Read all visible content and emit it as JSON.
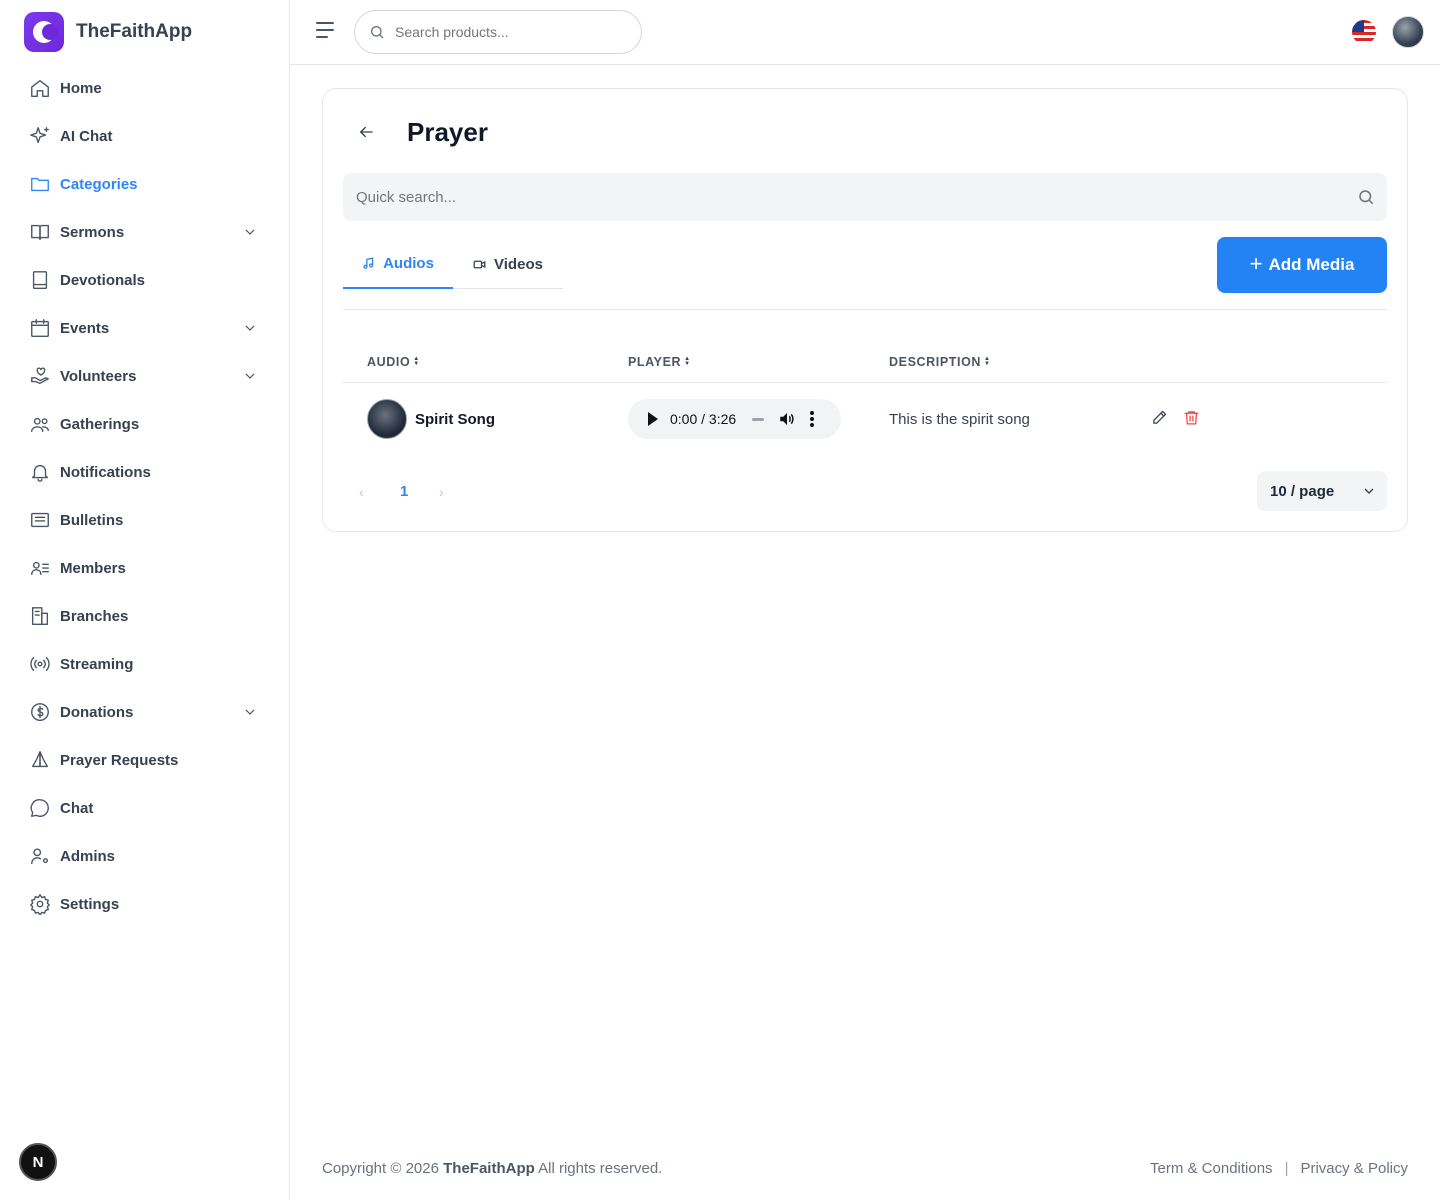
{
  "brand": {
    "name": "TheFaithApp"
  },
  "sidebar": {
    "items": [
      {
        "label": "Home",
        "icon": "home-icon",
        "has_chevron": false,
        "active": false
      },
      {
        "label": "AI Chat",
        "icon": "sparkles-icon",
        "has_chevron": false,
        "active": false
      },
      {
        "label": "Categories",
        "icon": "folder-icon",
        "has_chevron": false,
        "active": true
      },
      {
        "label": "Sermons",
        "icon": "book-open-icon",
        "has_chevron": true,
        "active": false
      },
      {
        "label": "Devotionals",
        "icon": "book-icon",
        "has_chevron": false,
        "active": false
      },
      {
        "label": "Events",
        "icon": "calendar-icon",
        "has_chevron": true,
        "active": false
      },
      {
        "label": "Volunteers",
        "icon": "hand-heart-icon",
        "has_chevron": true,
        "active": false
      },
      {
        "label": "Gatherings",
        "icon": "users-icon",
        "has_chevron": false,
        "active": false
      },
      {
        "label": "Notifications",
        "icon": "bell-icon",
        "has_chevron": false,
        "active": false
      },
      {
        "label": "Bulletins",
        "icon": "newspaper-icon",
        "has_chevron": false,
        "active": false
      },
      {
        "label": "Members",
        "icon": "user-list-icon",
        "has_chevron": false,
        "active": false
      },
      {
        "label": "Branches",
        "icon": "building-icon",
        "has_chevron": false,
        "active": false
      },
      {
        "label": "Streaming",
        "icon": "broadcast-icon",
        "has_chevron": false,
        "active": false
      },
      {
        "label": "Donations",
        "icon": "dollar-circle-icon",
        "has_chevron": true,
        "active": false
      },
      {
        "label": "Prayer Requests",
        "icon": "praying-hands-icon",
        "has_chevron": false,
        "active": false
      },
      {
        "label": "Chat",
        "icon": "chat-bubble-icon",
        "has_chevron": false,
        "active": false
      },
      {
        "label": "Admins",
        "icon": "user-cog-icon",
        "has_chevron": false,
        "active": false
      },
      {
        "label": "Settings",
        "icon": "gear-icon",
        "has_chevron": false,
        "active": false
      }
    ],
    "badge_letter": "N"
  },
  "header": {
    "search_placeholder": "Search products..."
  },
  "page": {
    "title": "Prayer",
    "quick_search_placeholder": "Quick search...",
    "tabs": [
      {
        "label": "Audios",
        "active": true
      },
      {
        "label": "Videos",
        "active": false
      }
    ],
    "add_button_label": "Add Media",
    "table": {
      "columns": [
        "AUDIO",
        "PLAYER",
        "DESCRIPTION"
      ],
      "rows": [
        {
          "title": "Spirit Song",
          "player_time": "0:00 / 3:26",
          "description": "This is the spirit song"
        }
      ]
    },
    "pagination": {
      "current_page": "1",
      "page_size_label": "10 / page"
    }
  },
  "footer": {
    "copyright_prefix": "Copyright © 2026",
    "copyright_brand": "TheFaithApp",
    "copyright_suffix": "All rights reserved.",
    "links": [
      "Term & Conditions",
      "Privacy & Policy"
    ]
  },
  "colors": {
    "accent": "#2f86f5",
    "primary_button": "#2383f5",
    "brand_purple": "#6d28d9",
    "danger": "#ef4444"
  }
}
